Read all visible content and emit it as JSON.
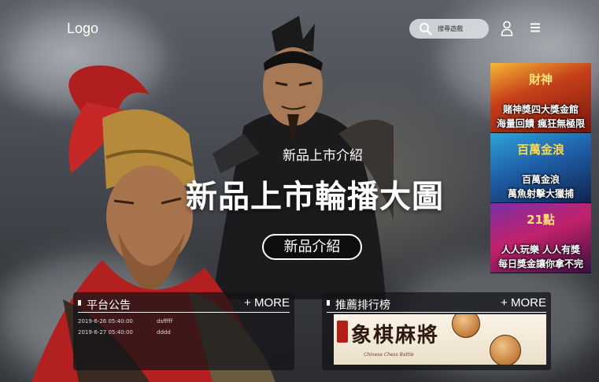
{
  "header": {
    "logo_text": "Logo",
    "search_placeholder": "搜尋遊戲",
    "icons": [
      "search-icon",
      "user-icon",
      "menu-icon"
    ]
  },
  "hero": {
    "subtitle": "新品上市介紹",
    "title": "新品上市輪播大圖",
    "button_label": "新品介紹"
  },
  "side_banners": [
    {
      "top_text": "財神",
      "mid_text": "賭神獎四大獎金館",
      "bottom_text": "海量回饋 瘋狂無極限"
    },
    {
      "top_text": "百萬金浪",
      "mid_text": "百萬金浪",
      "bottom_text": "萬魚射擊大獵捕"
    },
    {
      "top_text": "21點",
      "mid_text": "人人玩樂 人人有獎",
      "bottom_text": "每日獎金讓你拿不完"
    }
  ],
  "panels": {
    "announcements": {
      "title": "平台公告",
      "more_label": "+ MORE",
      "items": [
        {
          "date": "2019-6-26 05:40:00",
          "text": "dsfffff"
        },
        {
          "date": "2019-6-27 05:40:00",
          "text": "dddd"
        }
      ]
    },
    "ranking": {
      "title": "推薦排行榜",
      "more_label": "+ MORE",
      "banner_title": "象棋麻將",
      "banner_subtitle": "Chinese Chess Battle"
    }
  },
  "colors": {
    "panel_bg": "#141416",
    "search_bg": "#e1e4e8",
    "text": "#ffffff"
  }
}
